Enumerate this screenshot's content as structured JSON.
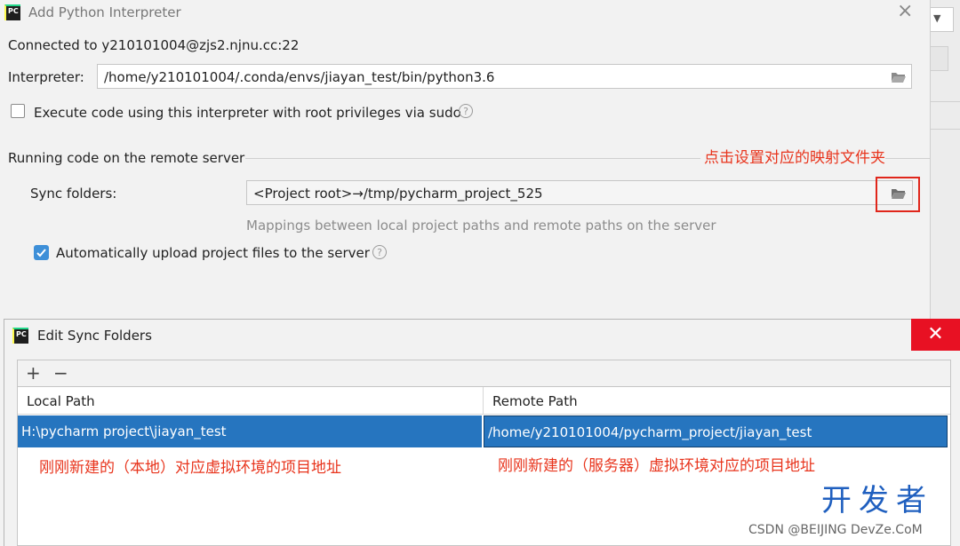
{
  "dialog_add": {
    "title": "Add Python Interpreter",
    "connected": "Connected to y210101004@zjs2.njnu.cc:22",
    "interpreter_label": "Interpreter:",
    "interpreter_value": "/home/y210101004/.conda/envs/jiayan_test/bin/python3.6",
    "root_privileges_label": "Execute code using this interpreter with root privileges via sudo",
    "root_privileges_checked": false,
    "section_title": "Running code on the remote server",
    "annotation": "点击设置对应的映射文件夹",
    "sync_folders_label": "Sync folders:",
    "sync_folders_value": "<Project root>→/tmp/pycharm_project_525",
    "sync_hint": "Mappings between local project paths and remote paths on the server",
    "auto_upload_label": "Automatically upload project files to the server",
    "auto_upload_checked": true
  },
  "dialog_sync": {
    "title": "Edit Sync Folders",
    "toolbar": {
      "add": "+",
      "remove": "−"
    },
    "columns": [
      "Local Path",
      "Remote Path"
    ],
    "rows": [
      {
        "local": "H:\\pycharm project\\jiayan_test",
        "remote": "/home/y210101004/pycharm_project/jiayan_test"
      }
    ],
    "annotation_local": "刚刚新建的（本地）对应虚拟环境的项目地址",
    "annotation_remote": "刚刚新建的（服务器）虚拟环境对应的项目地址"
  },
  "watermark": {
    "big": "开发者",
    "small": "CSDN @BEIJING DevZe.CoM"
  },
  "icons": {
    "app": "pycharm-logo-icon",
    "close": "close-icon",
    "folder": "folder-open-icon",
    "help": "help-icon",
    "check": "checkmark-icon"
  },
  "colors": {
    "selection": "#2675bf",
    "annotation": "#e8341c",
    "close_hover": "#e81123",
    "checkbox": "#3d8fd8"
  }
}
